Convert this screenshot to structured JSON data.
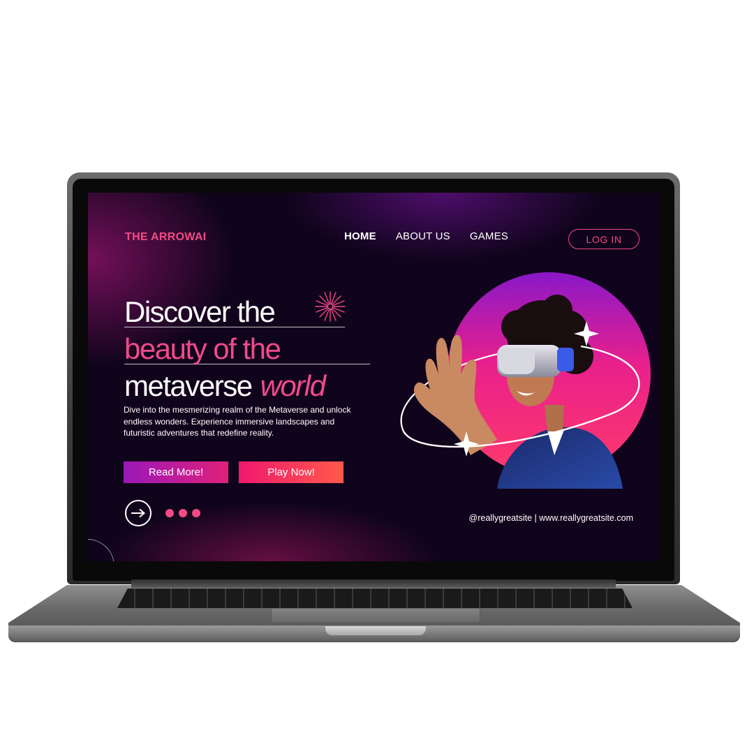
{
  "site": {
    "brand": "THE ARROWAI",
    "nav": [
      {
        "label": "HOME",
        "active": true
      },
      {
        "label": "ABOUT US",
        "active": false
      },
      {
        "label": "GAMES",
        "active": false
      }
    ],
    "login_label": "LOG IN"
  },
  "hero": {
    "line1": "Discover the",
    "line2": "beauty of the",
    "line3_plain": "metaverse",
    "line3_italic": "world",
    "body": "Dive into the mesmerizing realm of the Metaverse and unlock endless wonders. Experience immersive landscapes and futuristic adventures that redefine reality."
  },
  "buttons": {
    "read_more": "Read More!",
    "play_now": "Play Now!"
  },
  "footer": {
    "handles": "@reallygreatsite | www.reallygreatsite.com"
  },
  "colors": {
    "accent_pink": "#f24a86",
    "background": "#10041c",
    "read_gradient": [
      "#9a18b8",
      "#e0207a"
    ],
    "play_gradient": [
      "#f0186e",
      "#ff5a4a"
    ]
  },
  "icons": [
    "arrow-right-circle-icon",
    "sparkle-icon",
    "pagination-dots"
  ]
}
